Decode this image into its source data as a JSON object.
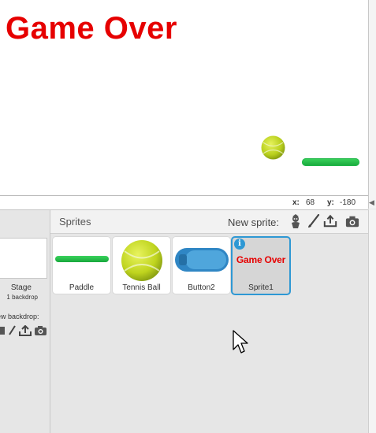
{
  "stage": {
    "game_over_text": "Game Over"
  },
  "coords": {
    "x_label": "x:",
    "x_value": "68",
    "y_label": "y:",
    "y_value": "-180"
  },
  "stage_pane": {
    "label": "Stage",
    "backdrops": "1 backdrop",
    "new_backdrop_label": "ew backdrop:"
  },
  "sprites_panel": {
    "title": "Sprites",
    "new_sprite_label": "New sprite:",
    "new_sprite_icons": [
      "sprite-library-icon",
      "paint-brush-icon",
      "upload-icon",
      "camera-icon"
    ],
    "sprites": [
      {
        "name": "Paddle",
        "icon": "paddle-thumb"
      },
      {
        "name": "Tennis Ball",
        "icon": "tennis-ball-thumb"
      },
      {
        "name": "Button2",
        "icon": "button-thumb"
      },
      {
        "name": "Sprite1",
        "icon": "game-over-thumb",
        "thumb_text": "Game Over",
        "selected": true
      }
    ],
    "info_badge": "i"
  },
  "colors": {
    "game_over_red": "#e60000",
    "paddle_green": "#22b84a",
    "selection_blue": "#2e98d4"
  }
}
